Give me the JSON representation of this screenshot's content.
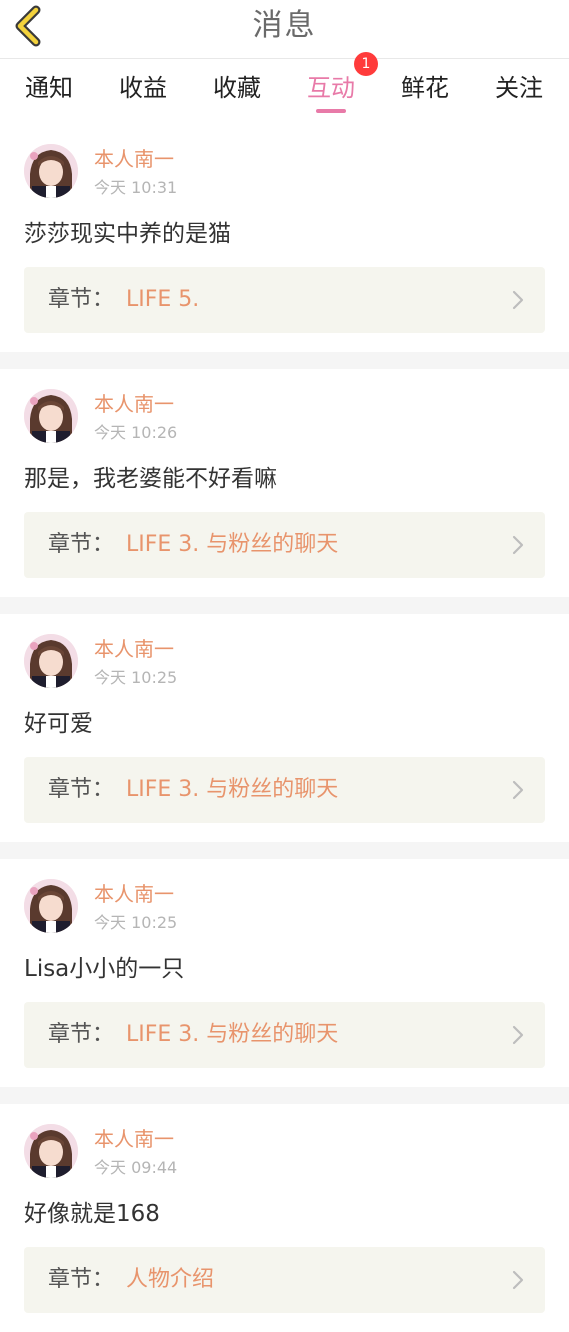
{
  "header": {
    "title": "消息",
    "back_icon": "chevron-left-icon"
  },
  "tabs": [
    {
      "label": "通知"
    },
    {
      "label": "收益"
    },
    {
      "label": "收藏"
    },
    {
      "label": "互动",
      "badge": "1",
      "active": true
    },
    {
      "label": "鲜花"
    },
    {
      "label": "关注"
    }
  ],
  "colors": {
    "accent_pink": "#e87aa8",
    "name_orange": "#e8946c",
    "badge_red": "#ff3b3b",
    "chapter_bg": "#f5f5ee"
  },
  "messages": [
    {
      "user": "本人南一",
      "time": "今天 10:31",
      "content": "莎莎现实中养的是猫",
      "chapter_label": "章节：",
      "chapter_name": "LIFE 5."
    },
    {
      "user": "本人南一",
      "time": "今天 10:26",
      "content": "那是，我老婆能不好看嘛",
      "chapter_label": "章节：",
      "chapter_name": "LIFE 3. 与粉丝的聊天"
    },
    {
      "user": "本人南一",
      "time": "今天 10:25",
      "content": "好可爱",
      "chapter_label": "章节：",
      "chapter_name": "LIFE 3. 与粉丝的聊天"
    },
    {
      "user": "本人南一",
      "time": "今天 10:25",
      "content": "Lisa小小的一只",
      "chapter_label": "章节：",
      "chapter_name": "LIFE 3. 与粉丝的聊天"
    },
    {
      "user": "本人南一",
      "time": "今天 09:44",
      "content": "好像就是168",
      "chapter_label": "章节：",
      "chapter_name": "人物介绍"
    }
  ]
}
